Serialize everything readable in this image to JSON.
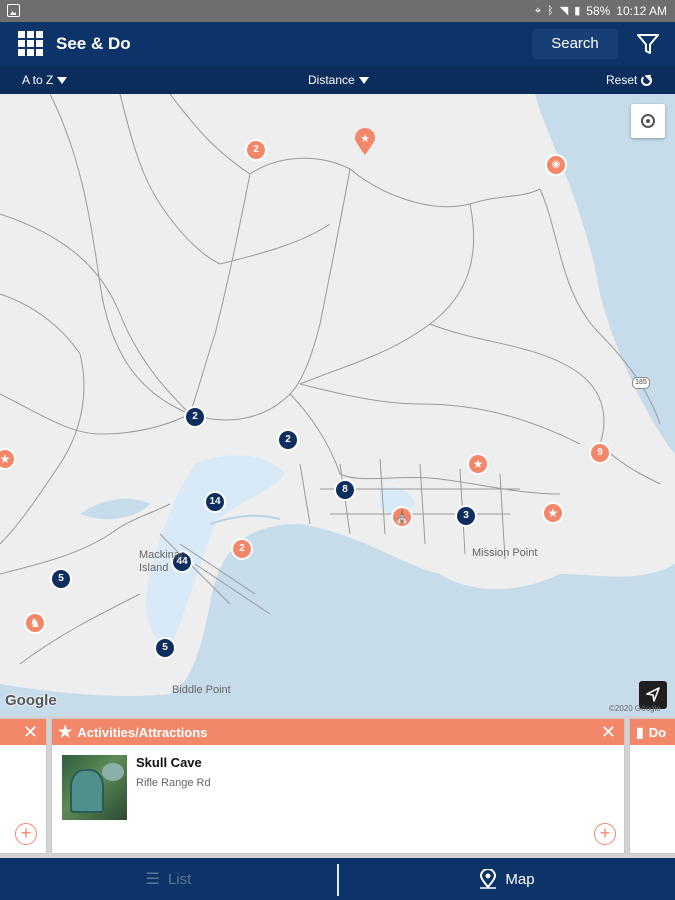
{
  "status_bar": {
    "battery": "58%",
    "time": "10:12 AM"
  },
  "app_bar": {
    "title": "See & Do",
    "search_label": "Search"
  },
  "sort_bar": {
    "sort_name": "A to Z",
    "sort_distance": "Distance",
    "reset": "Reset"
  },
  "map": {
    "clusters": [
      {
        "label": "2",
        "color": "#f3876a"
      },
      {
        "label": "2",
        "color": "#0d2e5e"
      },
      {
        "label": "2",
        "color": "#0d2e5e"
      },
      {
        "label": "14",
        "color": "#0d2e5e"
      },
      {
        "label": "8",
        "color": "#0d2e5e"
      },
      {
        "label": "3",
        "color": "#0d2e5e"
      },
      {
        "label": "2",
        "color": "#f3876a"
      },
      {
        "label": "44",
        "color": "#0d2e5e"
      },
      {
        "label": "5",
        "color": "#0d2e5e"
      },
      {
        "label": "5",
        "color": "#0d2e5e"
      },
      {
        "label": "9",
        "color": "#f3876a"
      }
    ],
    "place_labels": {
      "mission_point": "Mission Point",
      "mackinac_island": "Mackinac Island",
      "biddle_point": "Biddle Point",
      "road_shield": "185"
    },
    "attribution": "Google",
    "copyright": "©2020 Google"
  },
  "cards": {
    "active": {
      "category": "Activities/Attractions",
      "title": "Skull Cave",
      "subtitle": "Rifle Range Rd"
    },
    "next_category": "Do"
  },
  "tabs": {
    "list": "List",
    "map": "Map"
  },
  "colors": {
    "navy": "#0d3468",
    "coral": "#f3876a"
  }
}
